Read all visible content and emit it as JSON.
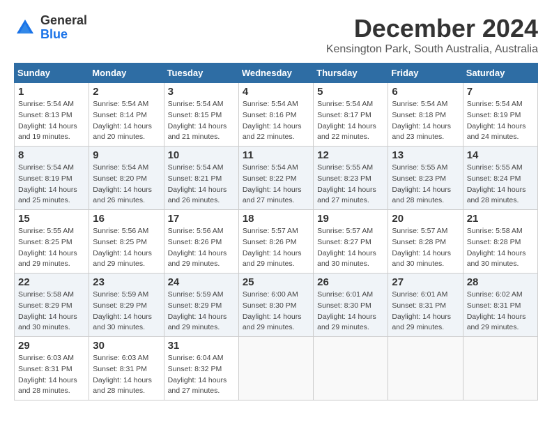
{
  "header": {
    "logo_general": "General",
    "logo_blue": "Blue",
    "month_title": "December 2024",
    "location": "Kensington Park, South Australia, Australia"
  },
  "weekdays": [
    "Sunday",
    "Monday",
    "Tuesday",
    "Wednesday",
    "Thursday",
    "Friday",
    "Saturday"
  ],
  "weeks": [
    [
      {
        "day": "1",
        "sunrise": "5:54 AM",
        "sunset": "8:13 PM",
        "daylight": "14 hours and 19 minutes."
      },
      {
        "day": "2",
        "sunrise": "5:54 AM",
        "sunset": "8:14 PM",
        "daylight": "14 hours and 20 minutes."
      },
      {
        "day": "3",
        "sunrise": "5:54 AM",
        "sunset": "8:15 PM",
        "daylight": "14 hours and 21 minutes."
      },
      {
        "day": "4",
        "sunrise": "5:54 AM",
        "sunset": "8:16 PM",
        "daylight": "14 hours and 22 minutes."
      },
      {
        "day": "5",
        "sunrise": "5:54 AM",
        "sunset": "8:17 PM",
        "daylight": "14 hours and 22 minutes."
      },
      {
        "day": "6",
        "sunrise": "5:54 AM",
        "sunset": "8:18 PM",
        "daylight": "14 hours and 23 minutes."
      },
      {
        "day": "7",
        "sunrise": "5:54 AM",
        "sunset": "8:19 PM",
        "daylight": "14 hours and 24 minutes."
      }
    ],
    [
      {
        "day": "8",
        "sunrise": "5:54 AM",
        "sunset": "8:19 PM",
        "daylight": "14 hours and 25 minutes."
      },
      {
        "day": "9",
        "sunrise": "5:54 AM",
        "sunset": "8:20 PM",
        "daylight": "14 hours and 26 minutes."
      },
      {
        "day": "10",
        "sunrise": "5:54 AM",
        "sunset": "8:21 PM",
        "daylight": "14 hours and 26 minutes."
      },
      {
        "day": "11",
        "sunrise": "5:54 AM",
        "sunset": "8:22 PM",
        "daylight": "14 hours and 27 minutes."
      },
      {
        "day": "12",
        "sunrise": "5:55 AM",
        "sunset": "8:23 PM",
        "daylight": "14 hours and 27 minutes."
      },
      {
        "day": "13",
        "sunrise": "5:55 AM",
        "sunset": "8:23 PM",
        "daylight": "14 hours and 28 minutes."
      },
      {
        "day": "14",
        "sunrise": "5:55 AM",
        "sunset": "8:24 PM",
        "daylight": "14 hours and 28 minutes."
      }
    ],
    [
      {
        "day": "15",
        "sunrise": "5:55 AM",
        "sunset": "8:25 PM",
        "daylight": "14 hours and 29 minutes."
      },
      {
        "day": "16",
        "sunrise": "5:56 AM",
        "sunset": "8:25 PM",
        "daylight": "14 hours and 29 minutes."
      },
      {
        "day": "17",
        "sunrise": "5:56 AM",
        "sunset": "8:26 PM",
        "daylight": "14 hours and 29 minutes."
      },
      {
        "day": "18",
        "sunrise": "5:57 AM",
        "sunset": "8:26 PM",
        "daylight": "14 hours and 29 minutes."
      },
      {
        "day": "19",
        "sunrise": "5:57 AM",
        "sunset": "8:27 PM",
        "daylight": "14 hours and 30 minutes."
      },
      {
        "day": "20",
        "sunrise": "5:57 AM",
        "sunset": "8:28 PM",
        "daylight": "14 hours and 30 minutes."
      },
      {
        "day": "21",
        "sunrise": "5:58 AM",
        "sunset": "8:28 PM",
        "daylight": "14 hours and 30 minutes."
      }
    ],
    [
      {
        "day": "22",
        "sunrise": "5:58 AM",
        "sunset": "8:29 PM",
        "daylight": "14 hours and 30 minutes."
      },
      {
        "day": "23",
        "sunrise": "5:59 AM",
        "sunset": "8:29 PM",
        "daylight": "14 hours and 30 minutes."
      },
      {
        "day": "24",
        "sunrise": "5:59 AM",
        "sunset": "8:29 PM",
        "daylight": "14 hours and 29 minutes."
      },
      {
        "day": "25",
        "sunrise": "6:00 AM",
        "sunset": "8:30 PM",
        "daylight": "14 hours and 29 minutes."
      },
      {
        "day": "26",
        "sunrise": "6:01 AM",
        "sunset": "8:30 PM",
        "daylight": "14 hours and 29 minutes."
      },
      {
        "day": "27",
        "sunrise": "6:01 AM",
        "sunset": "8:31 PM",
        "daylight": "14 hours and 29 minutes."
      },
      {
        "day": "28",
        "sunrise": "6:02 AM",
        "sunset": "8:31 PM",
        "daylight": "14 hours and 29 minutes."
      }
    ],
    [
      {
        "day": "29",
        "sunrise": "6:03 AM",
        "sunset": "8:31 PM",
        "daylight": "14 hours and 28 minutes."
      },
      {
        "day": "30",
        "sunrise": "6:03 AM",
        "sunset": "8:31 PM",
        "daylight": "14 hours and 28 minutes."
      },
      {
        "day": "31",
        "sunrise": "6:04 AM",
        "sunset": "8:32 PM",
        "daylight": "14 hours and 27 minutes."
      },
      null,
      null,
      null,
      null
    ]
  ]
}
